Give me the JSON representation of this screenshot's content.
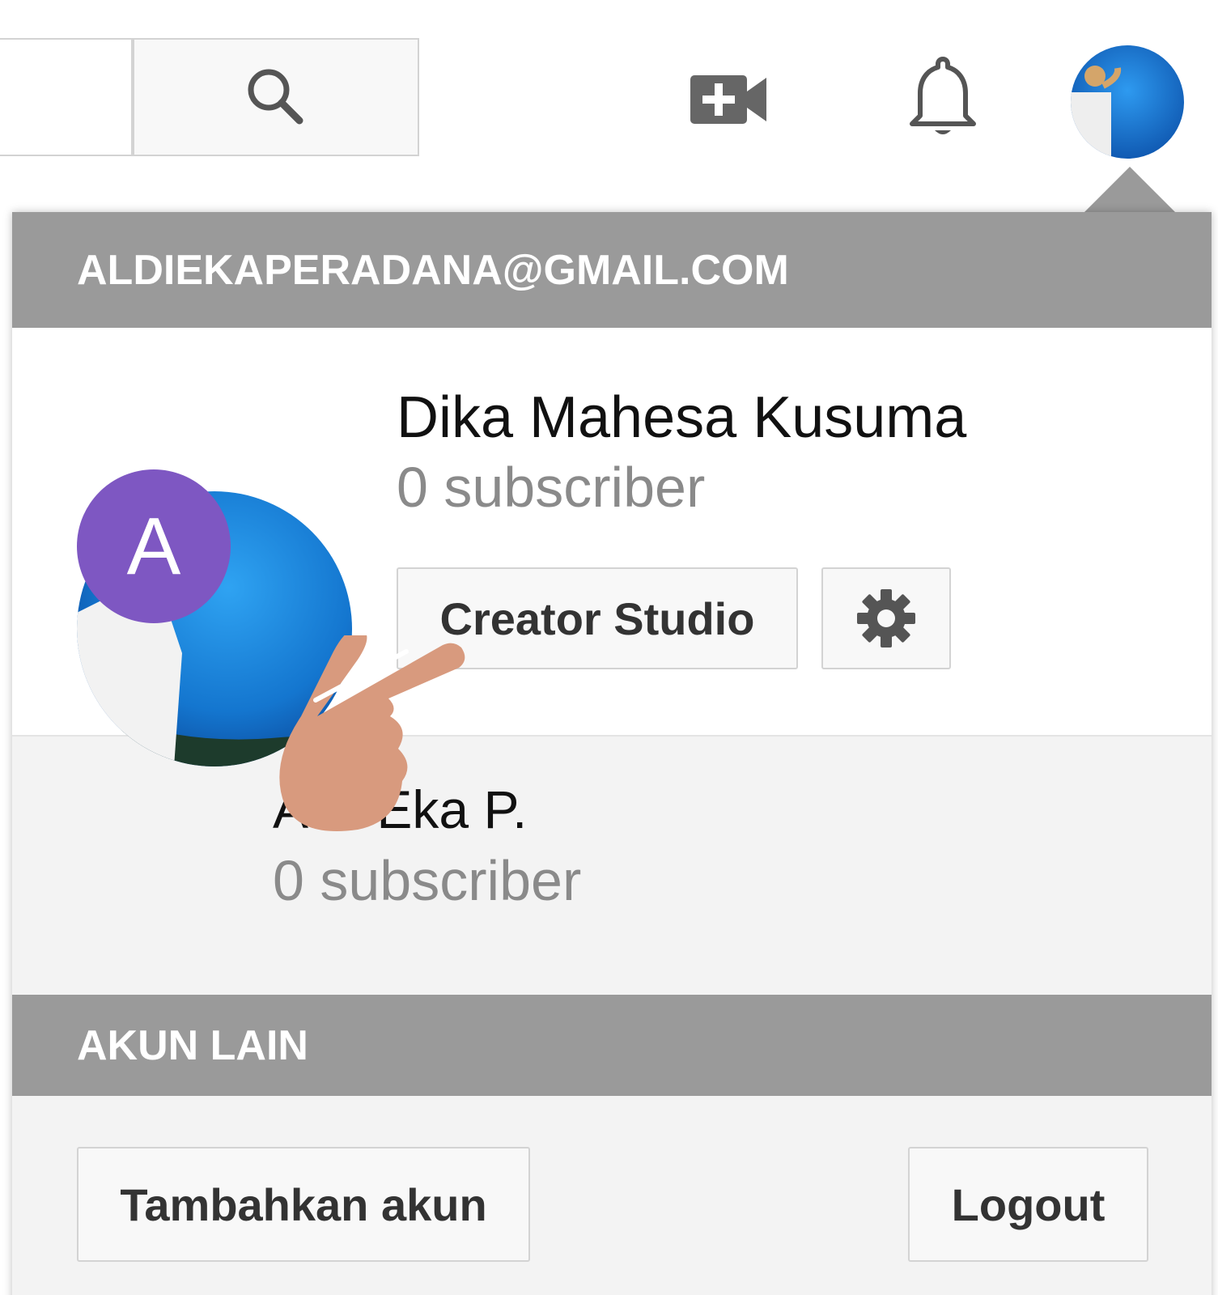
{
  "masthead": {
    "search_icon": "search-icon",
    "upload_icon": "video-add-icon",
    "notifications_icon": "bell-icon",
    "avatar": "avatar"
  },
  "account_menu": {
    "email": "ALDIEKAPERADANA@GMAIL.COM",
    "current_channel": {
      "name": "Dika Mahesa Kusuma",
      "subscribers": "0 subscriber",
      "creator_studio_label": "Creator Studio",
      "settings_icon": "gear-icon"
    },
    "other_channels": [
      {
        "initial": "A",
        "name": "Aldi Eka P.",
        "subscribers": "0 subscriber",
        "avatar_color": "#7e57c2"
      }
    ],
    "other_accounts_header": "AKUN LAIN",
    "add_account_label": "Tambahkan akun",
    "logout_label": "Logout"
  },
  "colors": {
    "header_gray": "#9a9a9a",
    "panel_bg": "#f3f3f3",
    "sky_blue": "#1b82d8",
    "hand_skin": "#d89a7e"
  },
  "annotation": {
    "pointer_icon": "pointing-hand-icon"
  }
}
